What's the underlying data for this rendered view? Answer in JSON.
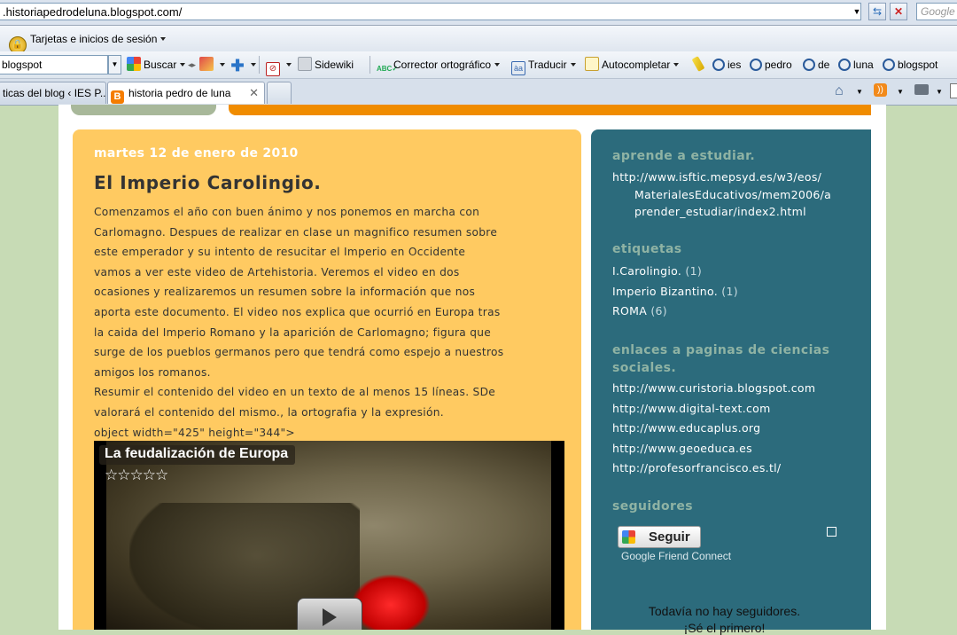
{
  "browser": {
    "url": ".historiapedrodeluna.blogspot.com/",
    "search_placeholder": "Google"
  },
  "toolbar1": {
    "signin_label": "Tarjetas e inicios de sesión"
  },
  "toolbar2": {
    "search_value": "blogspot",
    "buscar": "Buscar",
    "sidewiki": "Sidewiki",
    "corrector": "Corrector ortográfico",
    "traducir": "Traducir",
    "autocompletar": "Autocompletar",
    "highlight_terms": [
      "ies",
      "pedro",
      "de",
      "luna",
      "blogspot"
    ]
  },
  "tabs": [
    {
      "label": "tiсas del blog ‹ IES P..."
    },
    {
      "label": "historia pedro de luna"
    }
  ],
  "post": {
    "date": "martes 12 de enero de 2010",
    "title": "El Imperio Carolingio.",
    "lines": [
      "Comenzamos el año con buen ánimo y nos ponemos en marcha con",
      "Carlomagno. Despues de realizar en clase un magnifico resumen sobre",
      "este emperador y su intento de resucitar el Imperio en Occidente",
      "vamos a ver este video de Artehistoria. Veremos el video en dos",
      "ocasiones y realizaremos un resumen sobre la información que nos",
      "aporta este documento. El video nos explica que ocurrió en Europa tras",
      "la caida del Imperio Romano y la aparición de Carlomagno; figura que",
      "surge de los pueblos germanos pero que tendrá como espejo a nuestros",
      "amigos los romanos.",
      "Resumir el contenido del video en un texto de al menos 15 líneas. SDe",
      "valorará el contenido del mismo., la ortografia y la expresión.",
      "object width=\"425\" height=\"344\">"
    ],
    "video_title": "La feudalización de Europa",
    "video_rating": "☆☆☆☆☆"
  },
  "sidebar": {
    "aprende": {
      "heading": "aprende a estudiar.",
      "link_lines": [
        "http://www.isftic.mepsyd.es/w3/eos/",
        "MaterialesEducativos/mem2006/a",
        "prender_estudiar/index2.html"
      ]
    },
    "etiquetas": {
      "heading": "etiquetas",
      "items": [
        {
          "label": "I.Carolingio.",
          "count": "(1)"
        },
        {
          "label": "Imperio Bizantino.",
          "count": "(1)"
        },
        {
          "label": "ROMA",
          "count": "(6)"
        }
      ]
    },
    "enlaces": {
      "heading_lines": [
        "enlaces a paginas de ciencias",
        "sociales."
      ],
      "links": [
        "http://www.curistoria.blogspot.com",
        "http://www.digital-text.com",
        "http://www.educaplus.org",
        "http://www.geoeduca.es",
        "http://profesorfrancisco.es.tl/"
      ]
    },
    "seguidores": {
      "heading": "seguidores",
      "follow_button": "Seguir",
      "gfc": "Google Friend Connect",
      "none_yet": "Todavía no hay seguidores.",
      "be_first": "¡Sé el primero!"
    }
  },
  "colors": {
    "post_bg": "#ffca61",
    "sidebar_bg": "#2c6b7c",
    "page_bg": "#c7dbb5",
    "accent_orange": "#f08c00"
  }
}
